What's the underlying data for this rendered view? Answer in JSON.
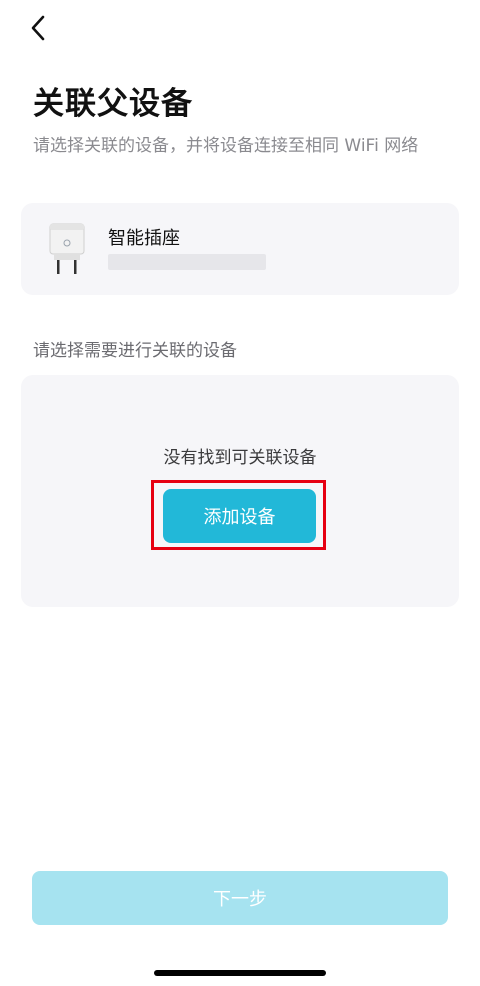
{
  "header": {
    "back_icon": "chevron-left-icon"
  },
  "page": {
    "title": "关联父设备",
    "subtitle": "请选择关联的设备，并将设备连接至相同 WiFi 网络"
  },
  "parent_device": {
    "name": "智能插座",
    "image_icon": "smart-plug-icon"
  },
  "child_section": {
    "label": "请选择需要进行关联的设备",
    "empty_text": "没有找到可关联设备",
    "add_button_label": "添加设备"
  },
  "footer": {
    "next_button_label": "下一步"
  },
  "colors": {
    "accent": "#22b8d8",
    "accent_disabled": "#a6e3f0",
    "highlight": "#e60012",
    "card_bg": "#f6f6f9"
  }
}
